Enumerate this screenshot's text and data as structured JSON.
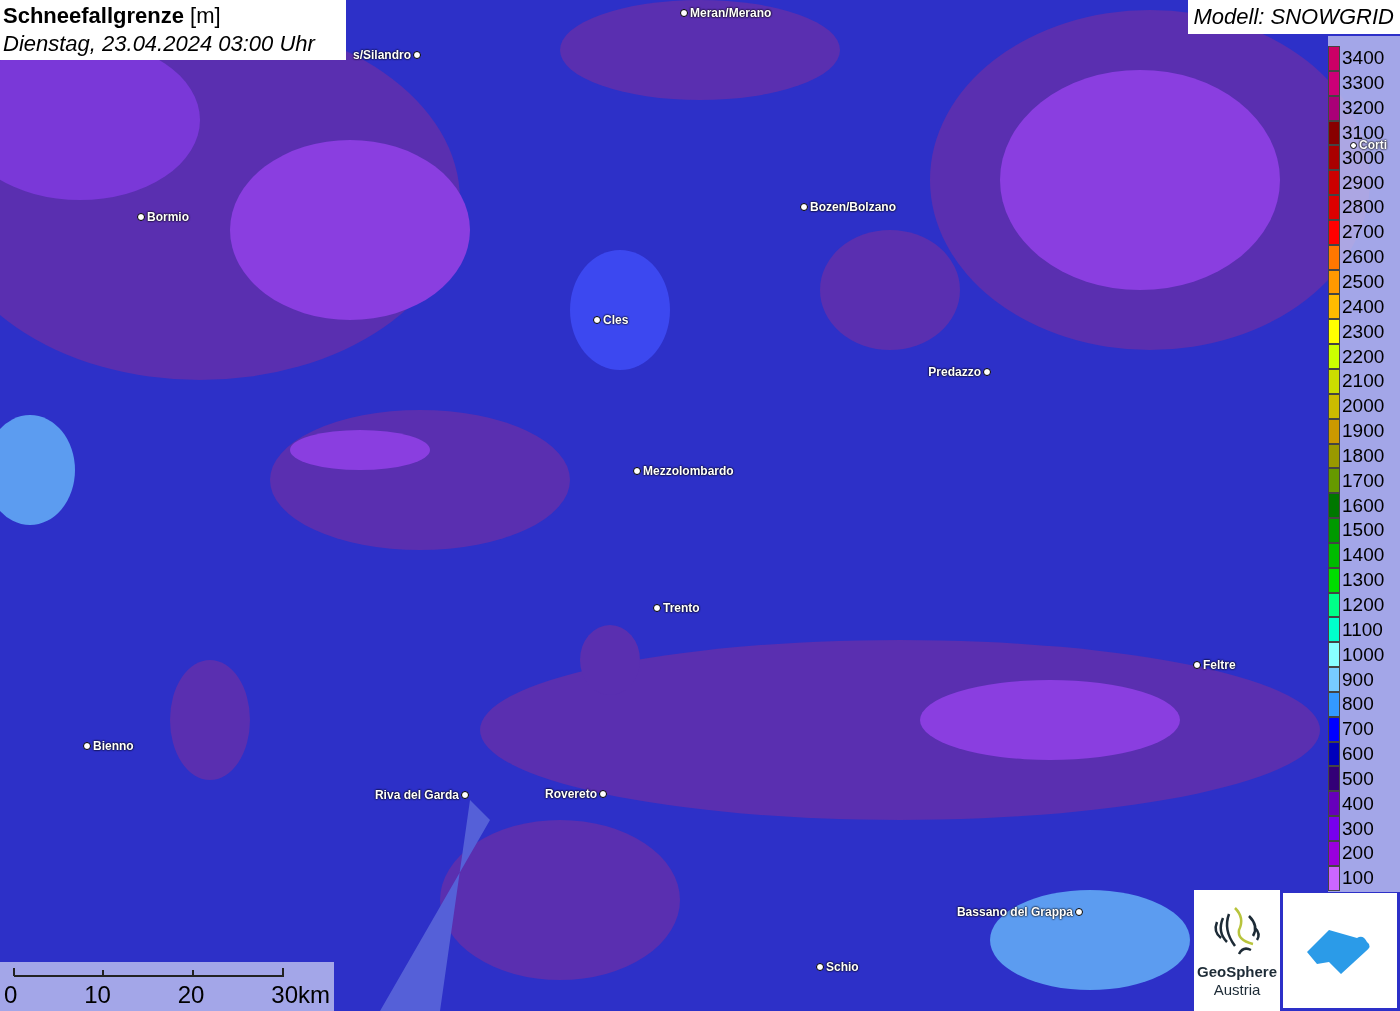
{
  "title": {
    "name": "Schneefallgrenze",
    "unit": "[m]",
    "date": "Dienstag, 23.04.2024 03:00 Uhr"
  },
  "model": "Modell: SNOWGRID",
  "cities": [
    "Meran/Merano",
    "s/Silandro",
    "Bormio",
    "Bozen/Bolzano",
    "Cles",
    "Predazzo",
    "Mezzolombardo",
    "Trento",
    "Feltre",
    "Bienno",
    "Riva del Garda",
    "Rovereto",
    "Bassano del Grappa",
    "Schio"
  ],
  "hidden_city": "Corti",
  "legend": [
    {
      "label": "3400",
      "color": "#cc0066"
    },
    {
      "label": "3300",
      "color": "#cc0077"
    },
    {
      "label": "3200",
      "color": "#aa0077"
    },
    {
      "label": "3100",
      "color": "#880000"
    },
    {
      "label": "3000",
      "color": "#aa0000"
    },
    {
      "label": "2900",
      "color": "#cc0000"
    },
    {
      "label": "2800",
      "color": "#dd0000"
    },
    {
      "label": "2700",
      "color": "#ff0000"
    },
    {
      "label": "2600",
      "color": "#ff7700"
    },
    {
      "label": "2500",
      "color": "#ff9900"
    },
    {
      "label": "2400",
      "color": "#ffbb00"
    },
    {
      "label": "2300",
      "color": "#ffff00"
    },
    {
      "label": "2200",
      "color": "#ccff00"
    },
    {
      "label": "2100",
      "color": "#ccdd00"
    },
    {
      "label": "2000",
      "color": "#ccbb00"
    },
    {
      "label": "1900",
      "color": "#cc9900"
    },
    {
      "label": "1800",
      "color": "#999900"
    },
    {
      "label": "1700",
      "color": "#669900"
    },
    {
      "label": "1600",
      "color": "#007700"
    },
    {
      "label": "1500",
      "color": "#009900"
    },
    {
      "label": "1400",
      "color": "#00bb00"
    },
    {
      "label": "1300",
      "color": "#00dd00"
    },
    {
      "label": "1200",
      "color": "#00ff88"
    },
    {
      "label": "1100",
      "color": "#00ffcc"
    },
    {
      "label": "1000",
      "color": "#88ffff"
    },
    {
      "label": "900",
      "color": "#77ccff"
    },
    {
      "label": "800",
      "color": "#3399ff"
    },
    {
      "label": "700",
      "color": "#0000ff"
    },
    {
      "label": "600",
      "color": "#0000bb"
    },
    {
      "label": "500",
      "color": "#330077"
    },
    {
      "label": "400",
      "color": "#6600bb"
    },
    {
      "label": "300",
      "color": "#7700ee"
    },
    {
      "label": "200",
      "color": "#9900dd"
    },
    {
      "label": "100",
      "color": "#cc66ff"
    }
  ],
  "scale": [
    "0",
    "10",
    "20",
    "30km"
  ],
  "logo": {
    "line1": "GeoSphere",
    "line2": "Austria"
  }
}
